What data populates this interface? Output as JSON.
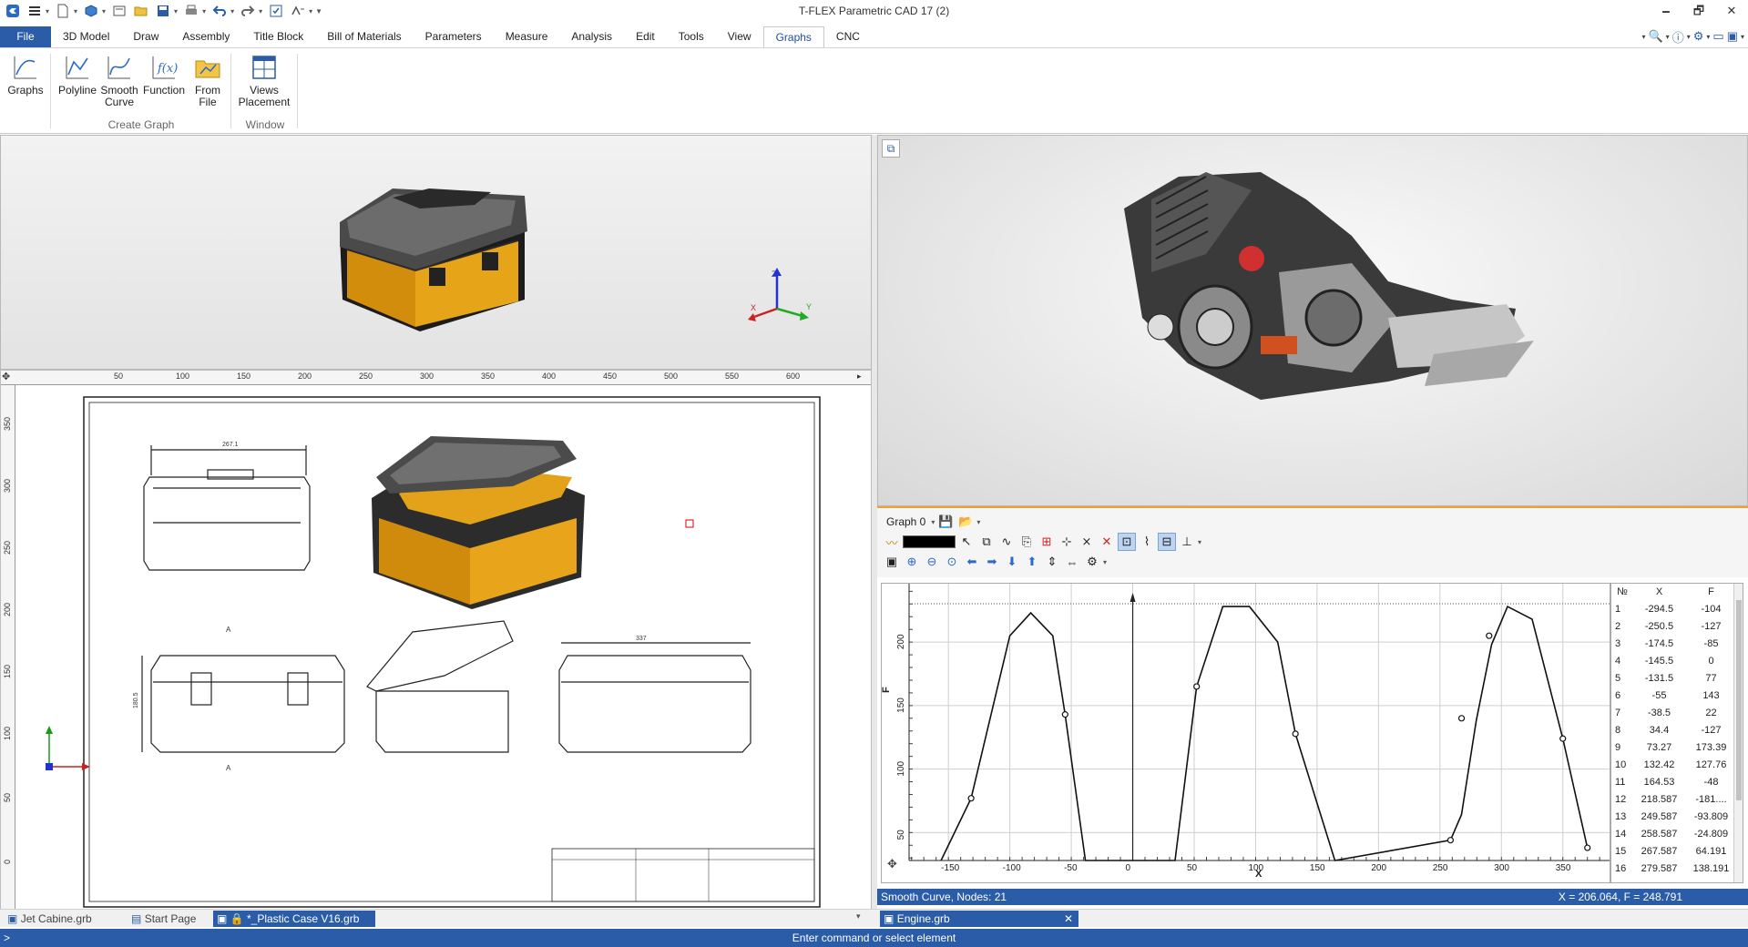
{
  "app_title": "T-FLEX Parametric CAD 17 (2)",
  "window_controls": {
    "minimize": "🗕",
    "restore": "🗗",
    "close": "✕"
  },
  "menu_tabs": [
    "File",
    "3D Model",
    "Draw",
    "Assembly",
    "Title Block",
    "Bill of Materials",
    "Parameters",
    "Measure",
    "Analysis",
    "Edit",
    "Tools",
    "View",
    "Graphs",
    "CNC"
  ],
  "active_tab": "Graphs",
  "ribbon": {
    "graphs_label": "Graphs",
    "polyline_label": "Polyline",
    "smooth_curve_label_1": "Smooth",
    "smooth_curve_label_2": "Curve",
    "function_label": "Function",
    "from_file_label_1": "From",
    "from_file_label_2": "File",
    "views_placement_label_1": "Views",
    "views_placement_label_2": "Placement",
    "group_create_graph": "Create Graph",
    "group_window": "Window"
  },
  "ruler": {
    "top_ticks": [
      "50",
      "100",
      "150",
      "200",
      "250",
      "300",
      "350",
      "400",
      "450",
      "500",
      "550",
      "600"
    ],
    "left_ticks": [
      "350",
      "300",
      "250",
      "200",
      "150",
      "100",
      "50",
      "0"
    ]
  },
  "drawing_dims": {
    "top_width": "267.1",
    "right_width": "337",
    "height": "180.5",
    "section_a": "A"
  },
  "graph": {
    "name": "Graph 0",
    "axis_x_label": "X",
    "axis_y_label": "F",
    "table_headers": [
      "№",
      "X",
      "F"
    ],
    "nodes": [
      [
        "1",
        "-294.5",
        "-104"
      ],
      [
        "2",
        "-250.5",
        "-127"
      ],
      [
        "3",
        "-174.5",
        "-85"
      ],
      [
        "4",
        "-145.5",
        "0"
      ],
      [
        "5",
        "-131.5",
        "77"
      ],
      [
        "6",
        "-55",
        "143"
      ],
      [
        "7",
        "-38.5",
        "22"
      ],
      [
        "8",
        "34.4",
        "-127"
      ],
      [
        "9",
        "73.27",
        "173.39"
      ],
      [
        "10",
        "132.42",
        "127.76"
      ],
      [
        "11",
        "164.53",
        "-48"
      ],
      [
        "12",
        "218.587",
        "-181...."
      ],
      [
        "13",
        "249.587",
        "-93.809"
      ],
      [
        "14",
        "258.587",
        "-24.809"
      ],
      [
        "15",
        "267.587",
        "64.191"
      ],
      [
        "16",
        "279.587",
        "138.191"
      ]
    ],
    "x_ticks": [
      "-150",
      "-100",
      "-50",
      "0",
      "50",
      "100",
      "150",
      "200",
      "250",
      "300",
      "350"
    ],
    "y_ticks": [
      "50",
      "100",
      "150",
      "200"
    ],
    "status_text": "Smooth Curve, Nodes: 21",
    "coords_text": "X = 206.064, F = 248.791"
  },
  "doc_tabs": [
    "Jet Cabine.grb",
    "Start Page",
    "*_Plastic Case V16.grb",
    "Engine.grb"
  ],
  "status_prompt": ">",
  "status_message": "Enter command or select element",
  "colors": {
    "accent": "#2a5ca8",
    "case_orange": "#d89010",
    "graph_highlight": "#f0a030"
  }
}
